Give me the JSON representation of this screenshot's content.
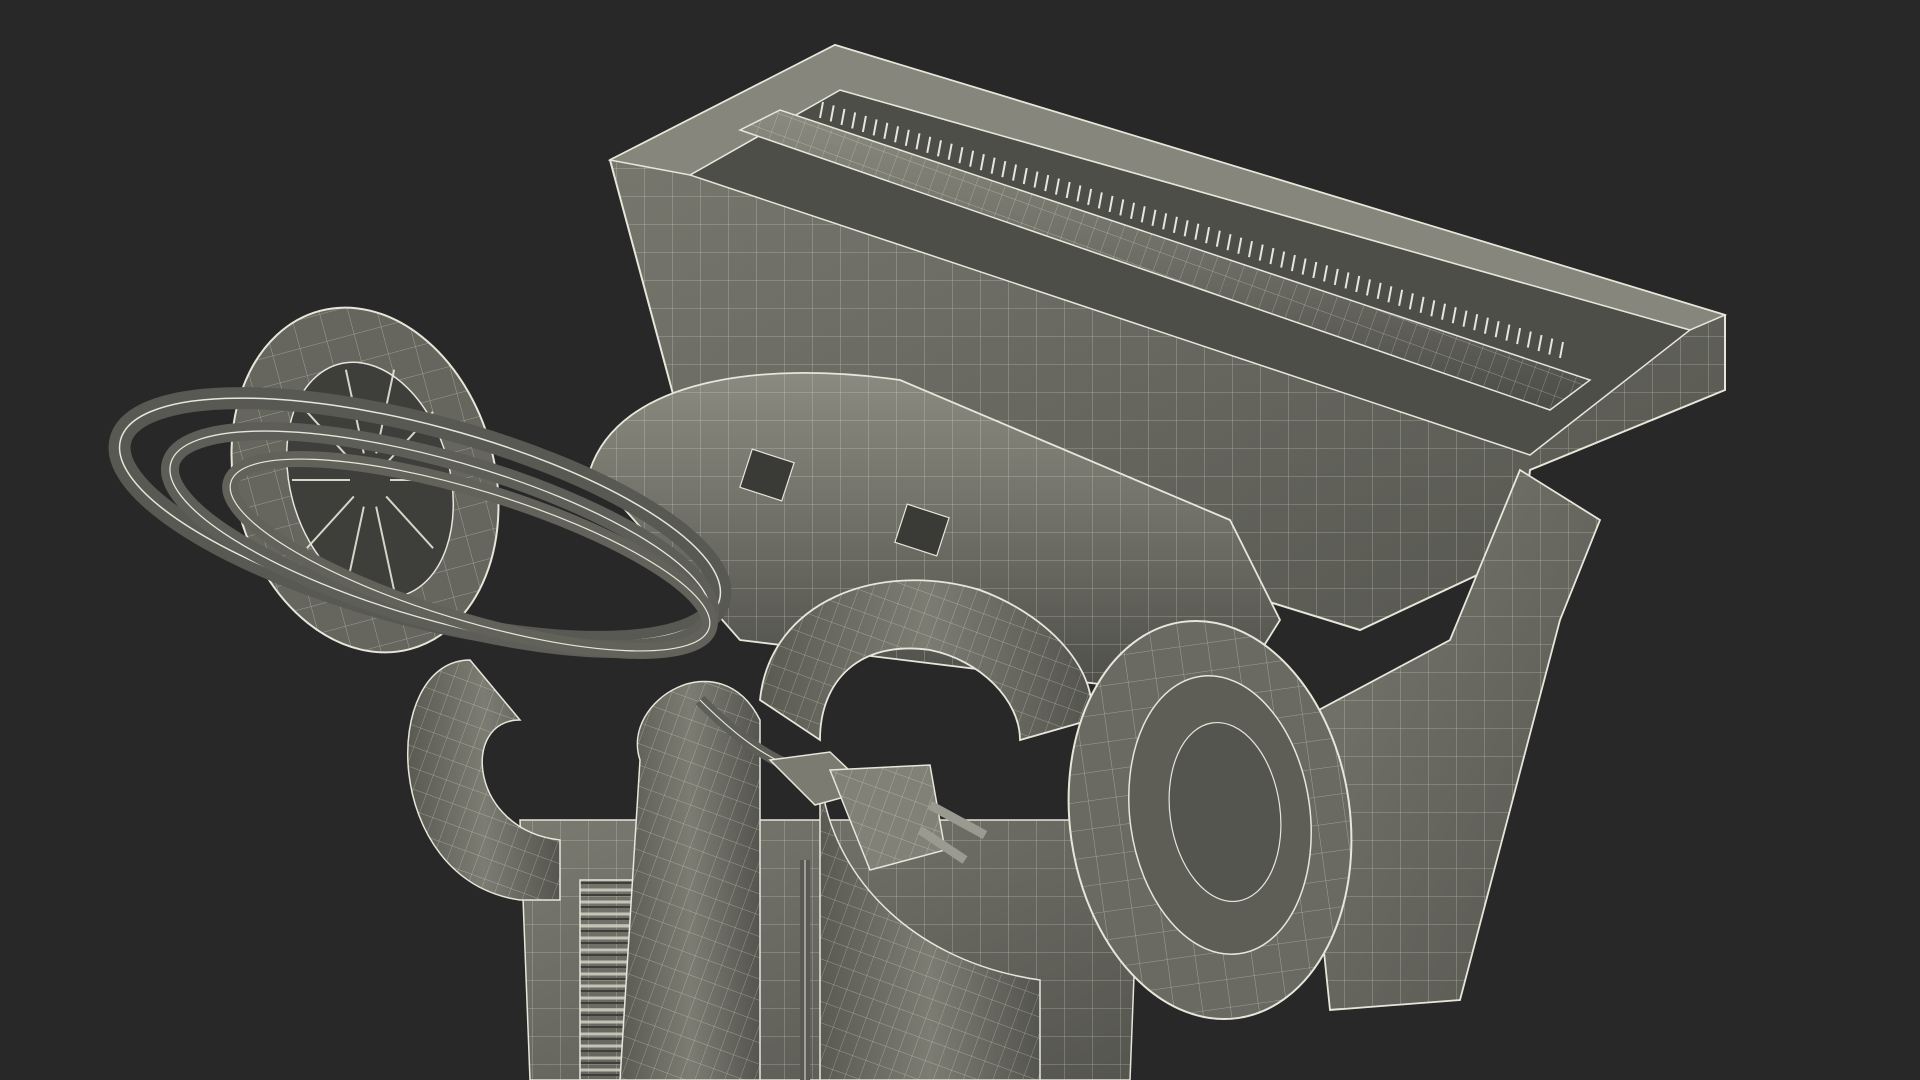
{
  "scene": {
    "background_color": "#282828",
    "subject": "wireframe-3d-model",
    "mesh_fill": "#6e6e66",
    "mesh_fill_dark": "#55554f",
    "mesh_fill_light": "#85857c",
    "wire_color": "#e6e6da"
  }
}
